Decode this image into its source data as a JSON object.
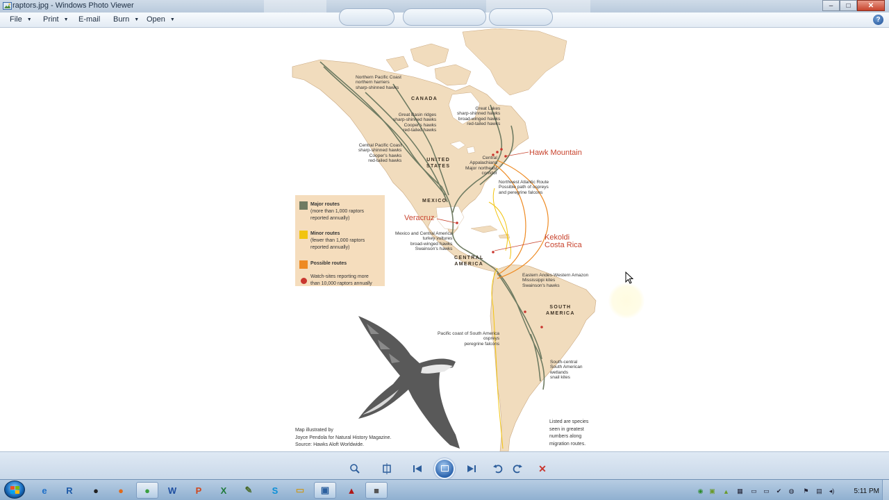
{
  "window": {
    "title": "raptors.jpg - Windows Photo Viewer",
    "minimize": "–",
    "maximize": "□",
    "close": "✕"
  },
  "menu": {
    "file": "File",
    "print": "Print",
    "email": "E-mail",
    "burn": "Burn",
    "open": "Open",
    "help": "?"
  },
  "map": {
    "countries": {
      "canada": "CANADA",
      "us_line1": "UNITED",
      "us_line2": "STATES",
      "mexico": "MEXICO",
      "central_america_line1": "CENTRAL",
      "central_america_line2": "AMERICA",
      "south_america_line1": "SOUTH",
      "south_america_line2": "AMERICA"
    },
    "routes": {
      "northern_pacific": {
        "title": "Northern Pacific Coast",
        "lines": [
          "northern harriers",
          "sharp-shinned hawks"
        ]
      },
      "great_basin": {
        "title": "Great Basin ridges",
        "lines": [
          "sharp-shinned hawks",
          "Cooper's hawks",
          "red-tailed hawks"
        ]
      },
      "great_lakes": {
        "title": "Great Lakes",
        "lines": [
          "sharp-shinned hawks",
          "broad-winged hawks",
          "red-tailed hawks"
        ]
      },
      "central_pacific": {
        "title": "Central Pacific Coast",
        "lines": [
          "sharp-shinned hawks",
          "Cooper's hawks",
          "red-tailed hawks"
        ]
      },
      "central_appalachians": {
        "title_lines": [
          "Central",
          "Appalachians"
        ],
        "lines": [
          "Major northeast",
          "corridor"
        ]
      },
      "northwest_atlantic": {
        "title": "Northwest Atlantic Route",
        "lines": [
          "Possible path of ospreys",
          "and peregrine falcons"
        ]
      },
      "mexico_central_america": {
        "title": "Mexico and Central America",
        "lines": [
          "turkey vultures",
          "broad-winged hawks",
          "Swainson's hawks"
        ]
      },
      "eastern_andes": {
        "title": "Eastern Andes-Western Amazon",
        "lines": [
          "Mississippi kites",
          "Swainson's hawks"
        ]
      },
      "pacific_south_america": {
        "title": "Pacific coast of South America",
        "lines": [
          "ospreys",
          "peregrine falcons"
        ]
      },
      "south_central": {
        "title_lines": [
          "South-central",
          "South American",
          "wetlands"
        ],
        "lines": [
          "snail kites"
        ]
      }
    },
    "watch_sites": {
      "hawk_mountain": "Hawk Mountain",
      "veracruz": "Veracruz",
      "kekoldi_line1": "Kekoldi",
      "kekoldi_line2": "Costa Rica"
    },
    "legend": {
      "major": [
        "Major routes",
        "(more than 1,000 raptors",
        "reported annually)"
      ],
      "minor": [
        "Minor routes",
        "(fewer than 1,000 raptors",
        "reported annually)"
      ],
      "possible": [
        "Possible routes"
      ],
      "watch": [
        "Watch-sites reporting more",
        "than 10,000 raptors annually"
      ],
      "colors": {
        "major": "#6f7b62",
        "minor": "#f2c40f",
        "possible": "#ee8a22",
        "watch": "#c9362f"
      }
    },
    "credit": [
      "Map illustrated by",
      "Joyce Pendola for Natural History Magazine.",
      "Source: Hawks Aloft Worldwide."
    ],
    "note": [
      "Listed are species",
      "seen in greatest",
      "numbers along",
      "migration routes."
    ]
  },
  "controls": [
    "zoom-icon",
    "actual-size-icon",
    "previous-icon",
    "slideshow-icon",
    "next-icon",
    "rotate-left-icon",
    "rotate-right-icon",
    "delete-icon"
  ],
  "taskbar": {
    "apps": [
      {
        "name": "ie",
        "glyph": "e",
        "color": "#1e6fc8"
      },
      {
        "name": "r",
        "glyph": "R",
        "color": "#1d5aa8"
      },
      {
        "name": "record",
        "glyph": "●",
        "color": "#222"
      },
      {
        "name": "firefox",
        "glyph": "●",
        "color": "#e06a1a"
      },
      {
        "name": "chrome",
        "glyph": "●",
        "color": "#3aa040"
      },
      {
        "name": "word",
        "glyph": "W",
        "color": "#1f4fa0"
      },
      {
        "name": "powerpoint",
        "glyph": "P",
        "color": "#d0461c"
      },
      {
        "name": "excel",
        "glyph": "X",
        "color": "#1f7a3a"
      },
      {
        "name": "notes",
        "glyph": "✎",
        "color": "#4a6b2a"
      },
      {
        "name": "skype",
        "glyph": "S",
        "color": "#0a8fd8"
      },
      {
        "name": "explorer",
        "glyph": "▭",
        "color": "#c89a2a"
      },
      {
        "name": "photo-viewer",
        "glyph": "▣",
        "color": "#2b5f9e"
      },
      {
        "name": "acrobat",
        "glyph": "▲",
        "color": "#b01818"
      },
      {
        "name": "camtasia",
        "glyph": "■",
        "color": "#555"
      }
    ],
    "clock": "5:11 PM"
  }
}
